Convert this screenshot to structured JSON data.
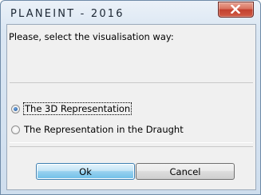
{
  "dialog": {
    "title": "PLANEINT - 2016",
    "close_icon": "close-x-icon",
    "prompt": "Please, select the visualisation way:"
  },
  "options": [
    {
      "label": "The 3D Representation",
      "selected": true
    },
    {
      "label": "The Representation in the Draught",
      "selected": false
    }
  ],
  "buttons": {
    "ok": "Ok",
    "cancel": "Cancel"
  },
  "colors": {
    "close_button": "#c2412f",
    "default_button": "#6fbfe8"
  }
}
